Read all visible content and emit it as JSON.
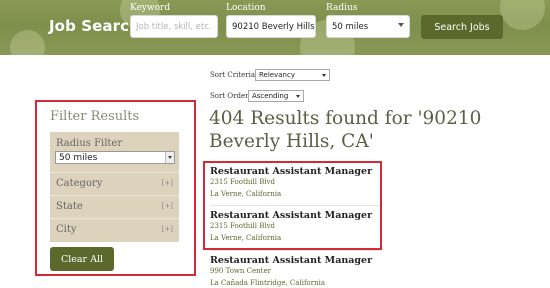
{
  "header": {
    "logo": "Job Search",
    "keyword": {
      "label": "Keyword",
      "placeholder": "Job title, skill, etc."
    },
    "location": {
      "label": "Location",
      "value": "90210 Beverly Hills, C"
    },
    "radius": {
      "label": "Radius",
      "value": "50 miles"
    },
    "search_button": "Search Jobs"
  },
  "sort": {
    "criteria_label": "Sort Criteria",
    "criteria_value": "Relevancy",
    "order_label": "Sort Order",
    "order_value": "Ascending"
  },
  "filter": {
    "title": "Filter Results",
    "radius_label": "Radius Filter",
    "radius_value": "50 miles",
    "rows": [
      {
        "label": "Category",
        "toggle": "[+]"
      },
      {
        "label": "State",
        "toggle": "[+]"
      },
      {
        "label": "City",
        "toggle": "[+]"
      }
    ],
    "clear_button": "Clear All"
  },
  "results": {
    "heading": "404 Results found for '90210 Beverly Hills, CA'",
    "jobs": [
      {
        "title": "Restaurant Assistant Manager",
        "address": "2315 Foothill Blvd",
        "city": "La Verne, California"
      },
      {
        "title": "Restaurant Assistant Manager",
        "address": "2315 Foothill Blvd",
        "city": "La Verne, California"
      },
      {
        "title": "Restaurant Assistant Manager",
        "address": "990 Town Center",
        "city": "La Cañada Flintridge, California"
      }
    ]
  },
  "colors": {
    "header_green": "#7e8f4c",
    "button_green": "#5b6a2c",
    "filter_panel": "#ddd3bd",
    "highlight_red": "#d22a37"
  }
}
